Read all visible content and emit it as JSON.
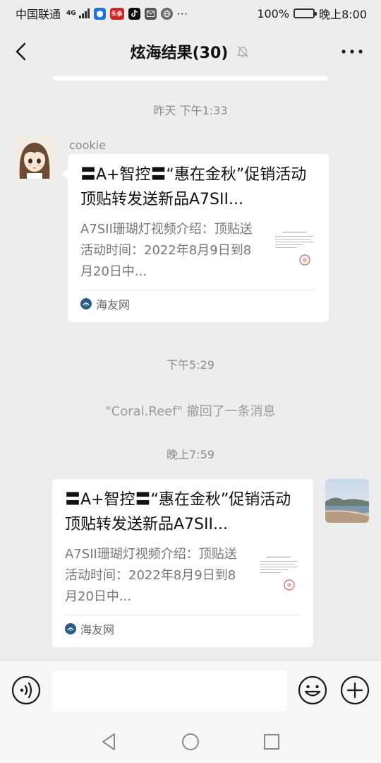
{
  "status_bar": {
    "carrier": "中国联通",
    "network": "4G",
    "app_badge_1": "头条",
    "more": "···",
    "battery": "100%",
    "time": "晚上8:00",
    "battery_level": 1.0
  },
  "header": {
    "title": "炫海结果(30)",
    "icons": [
      "back-arrow-icon",
      "mute-bell-icon",
      "more-dots-icon"
    ]
  },
  "messages": [
    {
      "timestamp": "昨天 下午1:33",
      "sender": "cookie",
      "side": "left",
      "card": {
        "title": "〓A+智控〓“惠在金秋”促销活动顶贴转发送新品A7SII...",
        "description": "A7SII珊瑚灯视频介绍：顶贴送活动时间：2022年8月9日到8月20日中...",
        "source": "海友网"
      }
    },
    {
      "timestamp": "下午5:29",
      "recall_notice": "\"Coral.Reef\" 撤回了一条消息"
    },
    {
      "timestamp": "晚上7:59",
      "side": "right",
      "card": {
        "title": "〓A+智控〓“惠在金秋”促销活动顶贴转发送新品A7SII...",
        "description": "A7SII珊瑚灯视频介绍：顶贴送活动时间：2022年8月9日到8月20日中...",
        "source": "海友网"
      }
    }
  ],
  "input_bar": {
    "value": "",
    "icons": [
      "voice-icon",
      "emoji-icon",
      "plus-icon"
    ]
  },
  "nav_bar": {
    "icons": [
      "nav-back-icon",
      "nav-home-icon",
      "nav-recent-icon"
    ]
  },
  "colors": {
    "background": "#ededed",
    "card": "#ffffff",
    "muted_text": "#8c8c8c"
  }
}
